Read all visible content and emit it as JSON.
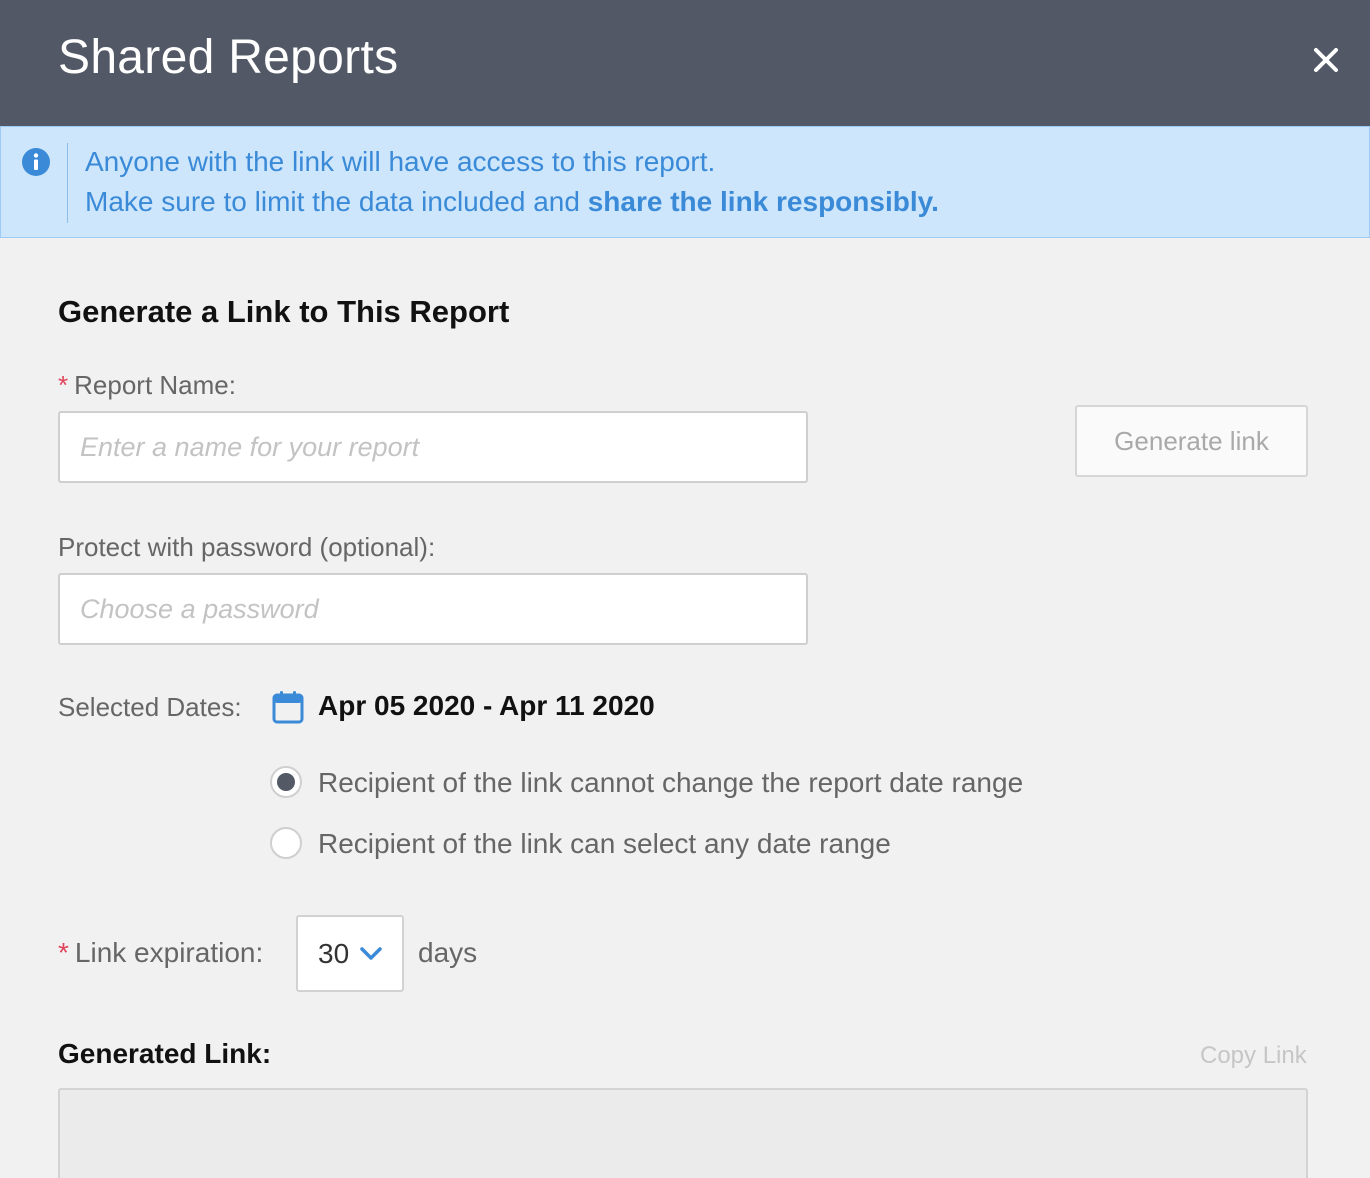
{
  "header": {
    "title": "Shared Reports"
  },
  "banner": {
    "line1": "Anyone with the link will have access to this report.",
    "line2_prefix": "Make sure to limit the data included and ",
    "line2_bold": "share the link responsibly."
  },
  "form": {
    "section_title": "Generate a Link to This Report",
    "required_mark": "*",
    "report_name_label": "Report Name:",
    "report_name_placeholder": "Enter a name for your report",
    "report_name_value": "",
    "generate_button": "Generate link",
    "password_label": "Protect with password (optional):",
    "password_placeholder": "Choose a password",
    "password_value": "",
    "dates_label": "Selected Dates:",
    "date_range": "Apr 05 2020 - Apr 11 2020",
    "radio_options": [
      {
        "label": "Recipient of the link cannot change the report date range",
        "checked": true
      },
      {
        "label": "Recipient of the link can select any date range",
        "checked": false
      }
    ],
    "expiration_label": "Link expiration:",
    "expiration_value": "30",
    "expiration_unit": "days",
    "generated_link_label": "Generated Link:",
    "copy_link": "Copy Link",
    "generated_link_value": ""
  },
  "colors": {
    "header_bg": "#525865",
    "banner_bg": "#cde6fb",
    "banner_text": "#3a8ad8",
    "accent": "#3a8ad8",
    "required": "#e0455d"
  },
  "icons": {
    "close": "close-icon",
    "info": "info-icon",
    "calendar": "calendar-icon",
    "chevron": "chevron-down-icon"
  }
}
